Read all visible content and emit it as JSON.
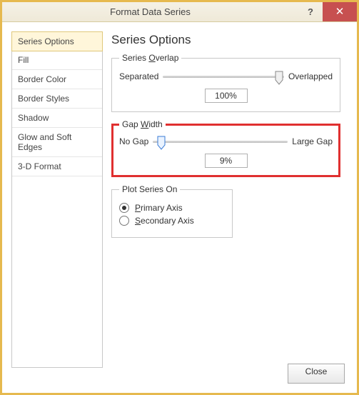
{
  "window": {
    "title": "Format Data Series",
    "help_label": "?",
    "close_label": "✕"
  },
  "sidebar": {
    "items": [
      {
        "label": "Series Options",
        "selected": true
      },
      {
        "label": "Fill"
      },
      {
        "label": "Border Color"
      },
      {
        "label": "Border Styles"
      },
      {
        "label": "Shadow"
      },
      {
        "label": "Glow and Soft Edges"
      },
      {
        "label": "3-D Format"
      }
    ]
  },
  "main": {
    "heading": "Series Options",
    "overlap": {
      "legend_prefix": "Series ",
      "legend_key": "O",
      "legend_suffix": "verlap",
      "left_label": "Separated",
      "right_label": "Overlapped",
      "value": "100%",
      "thumb_pos_pct": 96
    },
    "gap": {
      "legend_prefix": "Gap ",
      "legend_key": "W",
      "legend_suffix": "idth",
      "left_label": "No Gap",
      "right_label": "Large Gap",
      "value": "9%",
      "thumb_pos_pct": 6,
      "highlight": true
    },
    "plot_on": {
      "legend": "Plot Series On",
      "options": [
        {
          "pre": "",
          "key": "P",
          "post": "rimary Axis",
          "selected": true
        },
        {
          "pre": "",
          "key": "S",
          "post": "econdary Axis",
          "selected": false
        }
      ]
    }
  },
  "footer": {
    "close_label": "Close"
  },
  "colors": {
    "accent_border": "#e6b94f",
    "highlight_border": "#e03030",
    "close_bg": "#c75050"
  }
}
